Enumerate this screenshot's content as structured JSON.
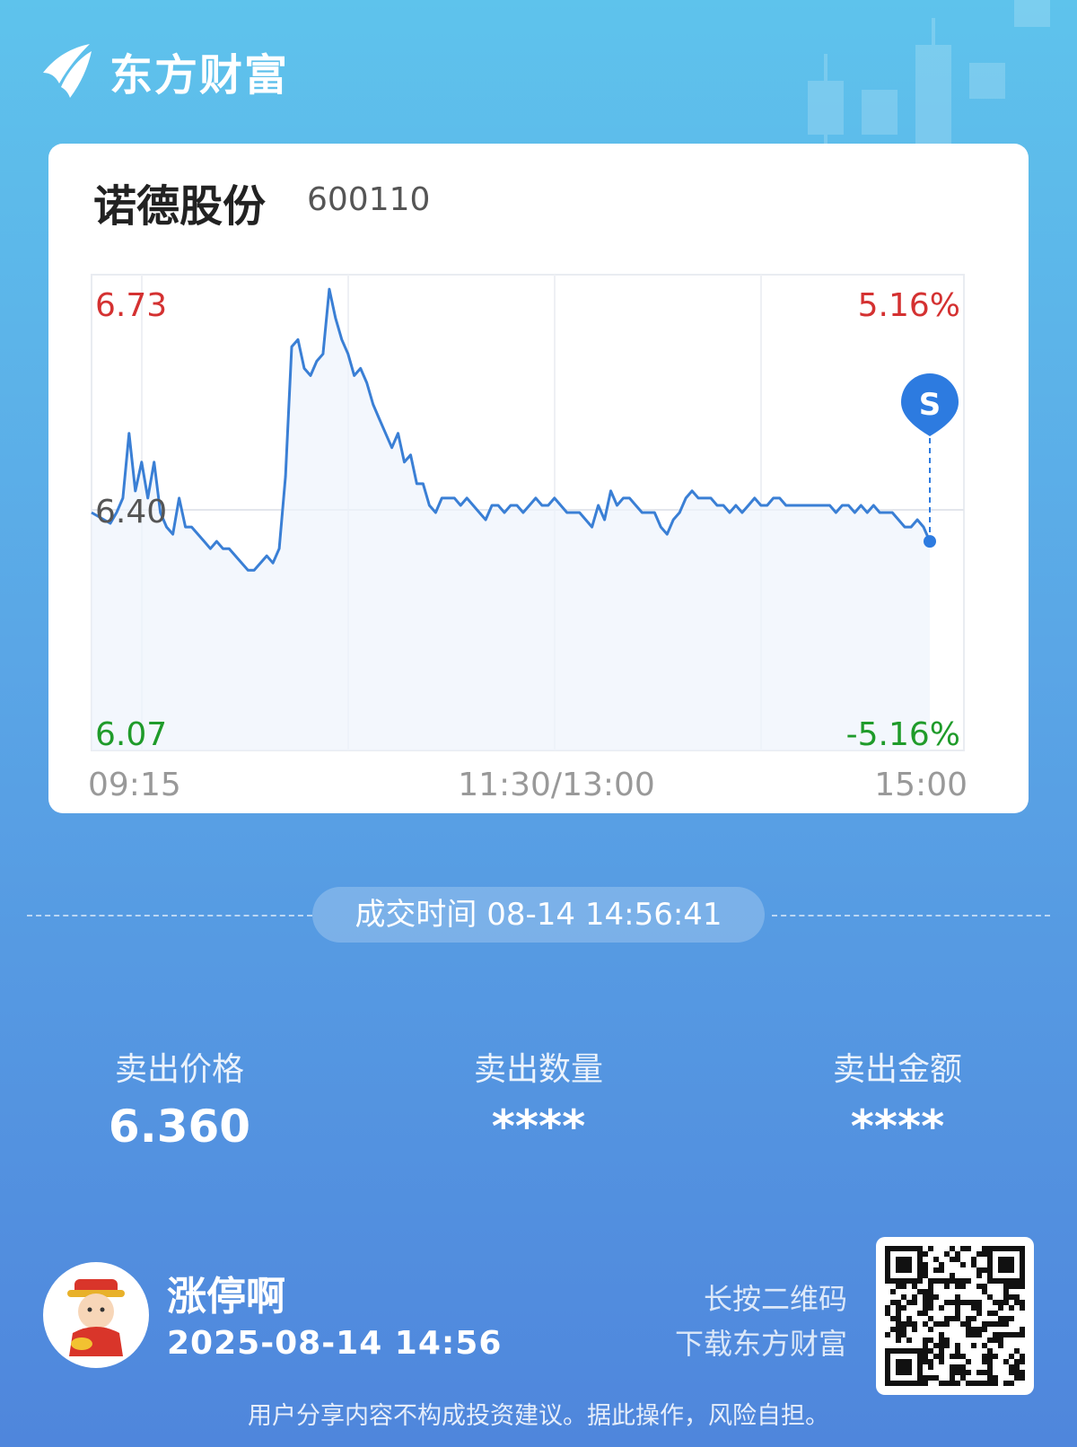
{
  "brand": {
    "name": "东方财富",
    "logo_icon": "eastmoney-logo-icon"
  },
  "stock": {
    "name": "诺德股份",
    "code": "600110"
  },
  "chart_data": {
    "type": "line",
    "title": "",
    "price_axis": {
      "top": "6.73",
      "mid": "6.40",
      "bottom": "6.07"
    },
    "percent_axis": {
      "top": "5.16%",
      "bottom": "-5.16%"
    },
    "time_labels": [
      "09:15",
      "11:30/13:00",
      "15:00"
    ],
    "ylim": [
      6.07,
      6.73
    ],
    "prev_close": 6.4,
    "marker": {
      "label": "S",
      "price": 6.36
    },
    "colors": {
      "line": "#3a7fd5",
      "up": "#d43131",
      "down": "#1f9b2a",
      "marker": "#2d7be0"
    },
    "series": [
      {
        "values": [
          6.4,
          6.395,
          6.39,
          6.385,
          6.4,
          6.42,
          6.51,
          6.43,
          6.47,
          6.42,
          6.47,
          6.4,
          6.38,
          6.37,
          6.42,
          6.38,
          6.38,
          6.37,
          6.36,
          6.35,
          6.36,
          6.35,
          6.35,
          6.34,
          6.33,
          6.32,
          6.32,
          6.33,
          6.34,
          6.33,
          6.35,
          6.45,
          6.63,
          6.64,
          6.6,
          6.59,
          6.61,
          6.62,
          6.71,
          6.67,
          6.64,
          6.62,
          6.59,
          6.6,
          6.58,
          6.55,
          6.53,
          6.51,
          6.49,
          6.51,
          6.47,
          6.48,
          6.44,
          6.44,
          6.41,
          6.4,
          6.42,
          6.42,
          6.42,
          6.41,
          6.42,
          6.41,
          6.4,
          6.39,
          6.41,
          6.41,
          6.4,
          6.41,
          6.41,
          6.4,
          6.41,
          6.42,
          6.41,
          6.41,
          6.42,
          6.41,
          6.4,
          6.4,
          6.4,
          6.39,
          6.38,
          6.41,
          6.39,
          6.43,
          6.41,
          6.42,
          6.42,
          6.41,
          6.4,
          6.4,
          6.4,
          6.38,
          6.37,
          6.39,
          6.4,
          6.42,
          6.43,
          6.42,
          6.42,
          6.42,
          6.41,
          6.41,
          6.4,
          6.41,
          6.4,
          6.41,
          6.42,
          6.41,
          6.41,
          6.42,
          6.42,
          6.41,
          6.41,
          6.41,
          6.41,
          6.41,
          6.41,
          6.41,
          6.41,
          6.4,
          6.41,
          6.41,
          6.4,
          6.41,
          6.4,
          6.41,
          6.4,
          6.4,
          6.4,
          6.39,
          6.38,
          6.38,
          6.39,
          6.38,
          6.36
        ]
      }
    ]
  },
  "trade": {
    "label": "成交时间",
    "time": "08-14 14:56:41"
  },
  "stats": [
    {
      "label": "卖出价格",
      "value": "6.360"
    },
    {
      "label": "卖出数量",
      "value": "****"
    },
    {
      "label": "卖出金额",
      "value": "****"
    }
  ],
  "user": {
    "name": "涨停啊",
    "time": "2025-08-14 14:56",
    "avatar_icon": "caishen-avatar-icon"
  },
  "qr": {
    "line1": "长按二维码",
    "line2": "下载东方财富"
  },
  "disclaimer": "用户分享内容不构成投资建议。据此操作，风险自担。"
}
